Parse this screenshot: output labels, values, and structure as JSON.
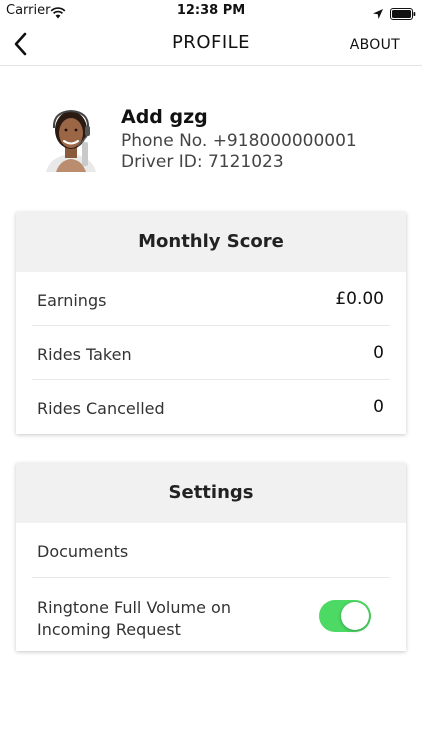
{
  "status_bar": {
    "carrier": "Carrier",
    "time": "12:38 PM"
  },
  "nav": {
    "title": "PROFILE",
    "about_label": "ABOUT"
  },
  "profile": {
    "name": "Add gzg",
    "phone_line": "Phone No. +918000000001",
    "driver_line": "Driver ID: 7121023"
  },
  "monthly_score": {
    "title": "Monthly Score",
    "rows": [
      {
        "label": "Earnings",
        "value": "£0.00"
      },
      {
        "label": "Rides Taken",
        "value": "0"
      },
      {
        "label": "Rides Cancelled",
        "value": "0"
      }
    ]
  },
  "settings": {
    "title": "Settings",
    "documents_label": "Documents",
    "ringtone_label": "Ringtone Full Volume on Incoming Request",
    "ringtone_enabled": true
  },
  "colors": {
    "toggle_on": "#4cd964",
    "card_header_bg": "#f1f1f1"
  }
}
